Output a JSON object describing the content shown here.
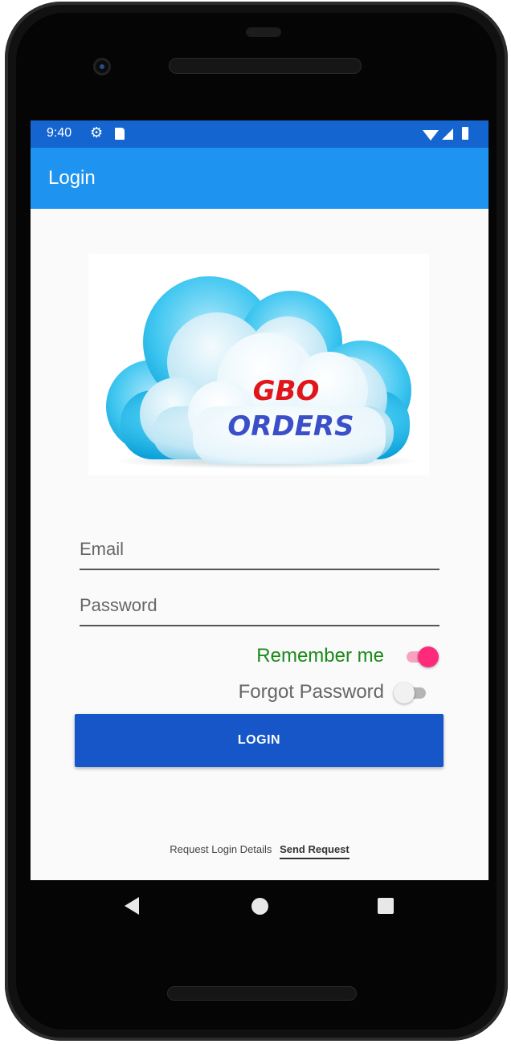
{
  "status_bar": {
    "time": "9:40"
  },
  "app_bar": {
    "title": "Login"
  },
  "logo": {
    "line1": "GBO",
    "line2": "ORDERS"
  },
  "form": {
    "email_placeholder": "Email",
    "password_placeholder": "Password",
    "remember_me_label": "Remember me",
    "remember_me_on": true,
    "forgot_password_label": "Forgot Password",
    "forgot_password_on": false,
    "login_button": "LOGIN"
  },
  "footer": {
    "request_text": "Request Login Details",
    "send_request_link": "Send Request"
  },
  "colors": {
    "status_bar": "#1565d0",
    "app_bar": "#1e94f0",
    "login_button": "#1656c8",
    "remember_label": "#1a8a1a",
    "switch_on": "#ff2a7a"
  }
}
